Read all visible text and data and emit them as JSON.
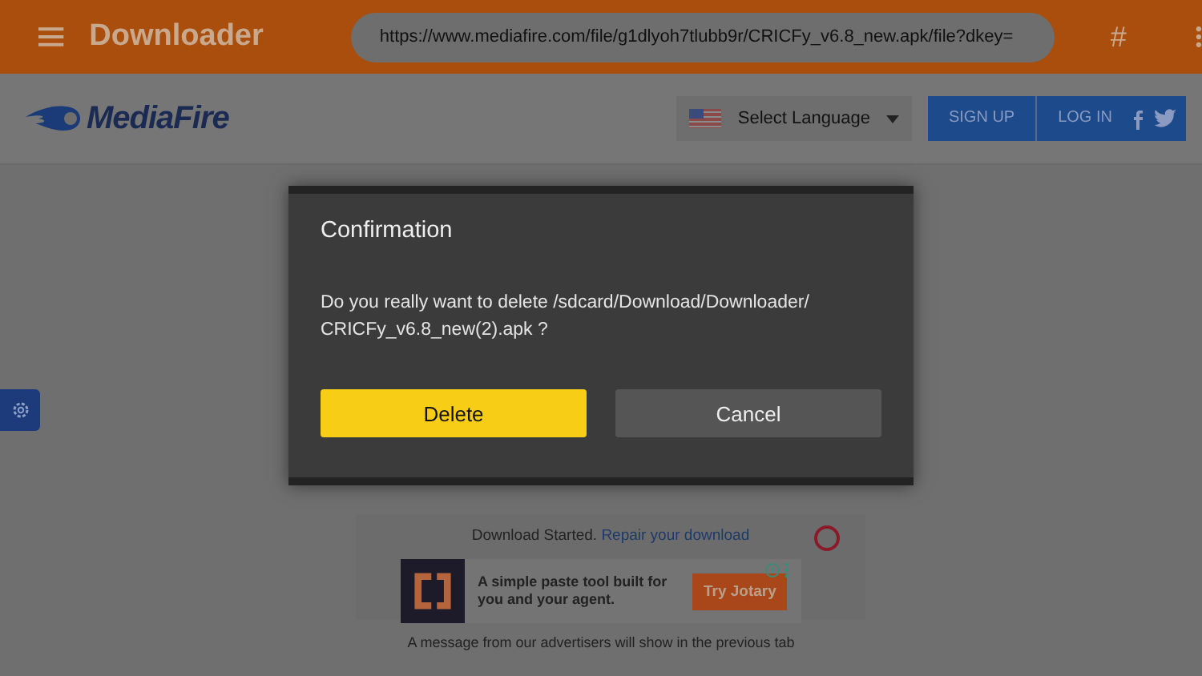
{
  "app_bar": {
    "title": "Downloader",
    "url": "https://www.mediafire.com/file/g1dlyoh7tlubb9r/CRICFy_v6.8_new.apk/file?dkey=",
    "shortcut": "#"
  },
  "site_header": {
    "logo": "MediaFire",
    "language": "Select Language",
    "buttons": [
      "SIGN UP",
      "LOG IN"
    ]
  },
  "download_box": {
    "status": "Download Started.",
    "repair_link": "Repair your download"
  },
  "ad": {
    "text": "A simple paste tool built for you and your agent.",
    "button": "Try Jotary"
  },
  "footer_note": "A message from our advertisers will show in the previous tab",
  "dialog": {
    "title": "Confirmation",
    "message": "Do you really want to delete /sdcard/Download/Downloader/ CRICFy_v6.8_new(2).apk ?",
    "buttons": [
      {
        "label": "Delete",
        "kind": "primary"
      },
      {
        "label": "Cancel",
        "kind": "secondary"
      }
    ]
  }
}
